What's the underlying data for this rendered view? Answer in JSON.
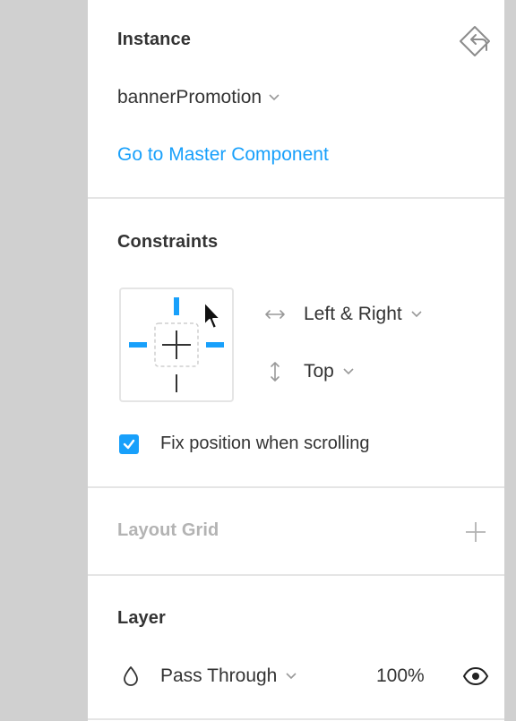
{
  "instance": {
    "title": "Instance",
    "component_name": "bannerPromotion",
    "master_link": "Go to Master Component"
  },
  "constraints": {
    "title": "Constraints",
    "horizontal": "Left & Right",
    "vertical": "Top",
    "fix_position_label": "Fix position when scrolling",
    "fix_position_checked": true
  },
  "layout_grid": {
    "title": "Layout Grid"
  },
  "layer": {
    "title": "Layer",
    "blend_mode": "Pass Through",
    "opacity": "100%"
  },
  "colors": {
    "accent": "#18a0fb",
    "text": "#333333",
    "muted": "#b3b3b3",
    "divider": "#e5e5e5",
    "canvas": "#d0d0d0"
  }
}
